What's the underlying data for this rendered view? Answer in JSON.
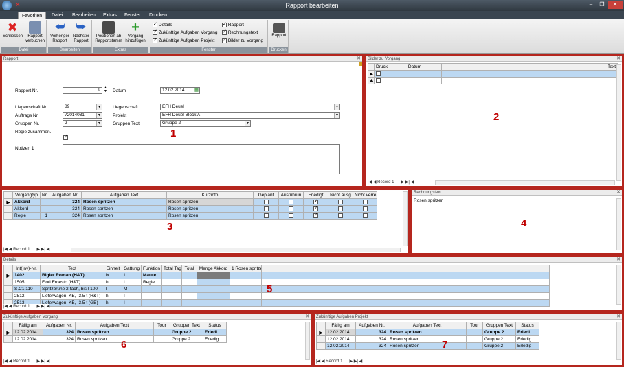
{
  "window": {
    "title": "Rapport bearbeiten",
    "min": "–",
    "max": "❐",
    "close": "✕"
  },
  "tabs": [
    "Favoriten",
    "Datei",
    "Bearbeiten",
    "Extras",
    "Fenster",
    "Drucken"
  ],
  "ribbon": {
    "datei": {
      "label": "Datei",
      "schliessen": "Schliessen",
      "verbuchen1": "Rapport",
      "verbuchen2": "verbuchen"
    },
    "bearbeiten": {
      "label": "Bearbeiten",
      "vor1": "Vorheriger",
      "vor2": "Rapport",
      "nach1": "Nächster",
      "nach2": "Rapport"
    },
    "extras": {
      "label": "Extras",
      "pos1": "Positionen ab",
      "pos2": "Rapportstamm",
      "vg1": "Vorgang",
      "vg2": "hinzufügen"
    },
    "fenster": {
      "label": "Fenster",
      "options": [
        {
          "label": "Details",
          "checked": true
        },
        {
          "label": "Zukünftige Aufgaben Vorgang",
          "checked": true
        },
        {
          "label": "Zukünftige Aufgaben Projekt",
          "checked": true
        },
        {
          "label": "Rapport",
          "checked": true
        },
        {
          "label": "Rechnungstext",
          "checked": true
        },
        {
          "label": "Bilder zu Vorgang",
          "checked": true
        }
      ]
    },
    "drucken": {
      "label": "Drucken",
      "rapport": "Rapport"
    }
  },
  "rapport": {
    "header": "Rapport",
    "num": "1",
    "rapport_nr_label": "Rapport Nr.",
    "rapport_nr": "9",
    "datum_label": "Datum",
    "datum": "12.02.2014",
    "liegenschaft_nr_label": "Liegenschaft Nr",
    "liegenschaft_nr": "89",
    "liegenschaft_label": "Liegenschaft",
    "liegenschaft": "EFH Deuel",
    "auftrags_nr_label": "Auftrags Nr.",
    "auftrags_nr": "72014031",
    "projekt_label": "Projekt",
    "projekt": "EFH Deuel Block A",
    "gruppen_nr_label": "Gruppen Nr.",
    "gruppen_nr": "2",
    "gruppen_text_label": "Gruppen Text",
    "gruppen_text": "Gruppe 2",
    "regie_label": "Regie zusammen.",
    "notizen_label": "Notizen 1"
  },
  "bilder": {
    "header": "Bilder zu Vorgang",
    "num": "2",
    "cols": [
      "Druck en",
      "Datum",
      "Text"
    ],
    "record": "Record",
    "record_num": "1"
  },
  "vorgang": {
    "num": "3",
    "record": "Record",
    "record_num": "1",
    "cols": [
      "Vorgangtyp",
      "Nr.",
      "Aufgaben Nr.",
      "Aufgaben Text",
      "Kurzinfo",
      "Geplant",
      "Ausführun",
      "Erledigt",
      "Nicht ausg",
      "Nicht verre"
    ],
    "rows": [
      {
        "typ": "Akkord",
        "nr": "",
        "anr": "324",
        "text": "Rosen spritzen",
        "kurz": "Rosen spritzen",
        "erledigt": true
      },
      {
        "typ": "Akkord",
        "nr": "",
        "anr": "324",
        "text": "Rosen spritzen",
        "kurz": "Rosen spritzen",
        "erledigt": true
      },
      {
        "typ": "Regie",
        "nr": "1",
        "anr": "324",
        "text": "Rosen spritzen",
        "kurz": "Rosen spritzen",
        "erledigt": true
      }
    ]
  },
  "rechnung": {
    "header": "Rechnungstext",
    "num": "4",
    "text": "Rosen spritzen"
  },
  "details": {
    "header": "Details",
    "num": "5",
    "record": "Record",
    "record_num": "1",
    "cols": [
      "Int(Inv)-Nr.",
      "Text",
      "Einheit",
      "Gattung",
      "Funktion",
      "Total Tag",
      "Total",
      "Menge Akkord",
      "1 Rosen spritze"
    ],
    "rows": [
      {
        "nr": "1402",
        "text": "Bigler Roman (H&T)",
        "einheit": "h",
        "gattung": "L",
        "funktion": "Maure"
      },
      {
        "nr": "1505",
        "text": "Fiori Ernesto (H&T)",
        "einheit": "h",
        "gattung": "L",
        "funktion": "Regie"
      },
      {
        "nr": "S.C1.110",
        "text": "Spritzbrühe 2-fach, bis l 100",
        "einheit": "l",
        "gattung": "M",
        "funktion": ""
      },
      {
        "nr": "2512",
        "text": "Lieferwagen, KB, -3.5 t (H&T)",
        "einheit": "h",
        "gattung": "I",
        "funktion": ""
      },
      {
        "nr": "2513",
        "text": "Lieferwagen, KB, -3.5 t (GB)",
        "einheit": "h",
        "gattung": "I",
        "funktion": ""
      }
    ]
  },
  "zav": {
    "header": "Zukünftige Aufgaben Vorgang",
    "num": "6",
    "record": "Record",
    "record_num": "1",
    "cols": [
      "Fällig am",
      "Aufgaben Nr.",
      "Aufgaben Text",
      "Tour",
      "Gruppen Text",
      "Status"
    ],
    "rows": [
      {
        "date": "12.02.2014",
        "anr": "324",
        "text": "Rosen spritzen",
        "tour": "",
        "gruppe": "Gruppe 2",
        "status": "Erledi"
      },
      {
        "date": "12.02.2014",
        "anr": "324",
        "text": "Rosen spritzen",
        "tour": "",
        "gruppe": "Gruppe 2",
        "status": "Erledig"
      }
    ]
  },
  "zap": {
    "header": "Zukünftige Aufgaben Projekt",
    "num": "7",
    "record": "Record",
    "record_num": "1",
    "cols": [
      "Fällig am",
      "Aufgaben Nr.",
      "Aufgaben Text",
      "Tour",
      "Gruppen Text",
      "Status"
    ],
    "rows": [
      {
        "date": "12.02.2014",
        "anr": "324",
        "text": "Rosen spritzen",
        "tour": "",
        "gruppe": "Gruppe 2",
        "status": "Erledi"
      },
      {
        "date": "12.02.2014",
        "anr": "324",
        "text": "Rosen spritzen",
        "tour": "",
        "gruppe": "Gruppe 2",
        "status": "Erledig"
      },
      {
        "date": "12.02.2014",
        "anr": "324",
        "text": "Rosen spritzen",
        "tour": "",
        "gruppe": "Gruppe 2",
        "status": "Erledig"
      }
    ]
  }
}
